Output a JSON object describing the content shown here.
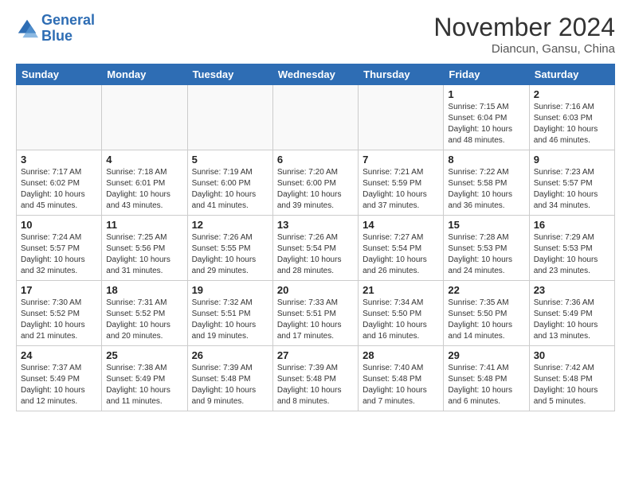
{
  "header": {
    "logo_line1": "General",
    "logo_line2": "Blue",
    "month": "November 2024",
    "location": "Diancun, Gansu, China"
  },
  "days_of_week": [
    "Sunday",
    "Monday",
    "Tuesday",
    "Wednesday",
    "Thursday",
    "Friday",
    "Saturday"
  ],
  "weeks": [
    [
      {
        "day": "",
        "info": ""
      },
      {
        "day": "",
        "info": ""
      },
      {
        "day": "",
        "info": ""
      },
      {
        "day": "",
        "info": ""
      },
      {
        "day": "",
        "info": ""
      },
      {
        "day": "1",
        "info": "Sunrise: 7:15 AM\nSunset: 6:04 PM\nDaylight: 10 hours and 48 minutes."
      },
      {
        "day": "2",
        "info": "Sunrise: 7:16 AM\nSunset: 6:03 PM\nDaylight: 10 hours and 46 minutes."
      }
    ],
    [
      {
        "day": "3",
        "info": "Sunrise: 7:17 AM\nSunset: 6:02 PM\nDaylight: 10 hours and 45 minutes."
      },
      {
        "day": "4",
        "info": "Sunrise: 7:18 AM\nSunset: 6:01 PM\nDaylight: 10 hours and 43 minutes."
      },
      {
        "day": "5",
        "info": "Sunrise: 7:19 AM\nSunset: 6:00 PM\nDaylight: 10 hours and 41 minutes."
      },
      {
        "day": "6",
        "info": "Sunrise: 7:20 AM\nSunset: 6:00 PM\nDaylight: 10 hours and 39 minutes."
      },
      {
        "day": "7",
        "info": "Sunrise: 7:21 AM\nSunset: 5:59 PM\nDaylight: 10 hours and 37 minutes."
      },
      {
        "day": "8",
        "info": "Sunrise: 7:22 AM\nSunset: 5:58 PM\nDaylight: 10 hours and 36 minutes."
      },
      {
        "day": "9",
        "info": "Sunrise: 7:23 AM\nSunset: 5:57 PM\nDaylight: 10 hours and 34 minutes."
      }
    ],
    [
      {
        "day": "10",
        "info": "Sunrise: 7:24 AM\nSunset: 5:57 PM\nDaylight: 10 hours and 32 minutes."
      },
      {
        "day": "11",
        "info": "Sunrise: 7:25 AM\nSunset: 5:56 PM\nDaylight: 10 hours and 31 minutes."
      },
      {
        "day": "12",
        "info": "Sunrise: 7:26 AM\nSunset: 5:55 PM\nDaylight: 10 hours and 29 minutes."
      },
      {
        "day": "13",
        "info": "Sunrise: 7:26 AM\nSunset: 5:54 PM\nDaylight: 10 hours and 28 minutes."
      },
      {
        "day": "14",
        "info": "Sunrise: 7:27 AM\nSunset: 5:54 PM\nDaylight: 10 hours and 26 minutes."
      },
      {
        "day": "15",
        "info": "Sunrise: 7:28 AM\nSunset: 5:53 PM\nDaylight: 10 hours and 24 minutes."
      },
      {
        "day": "16",
        "info": "Sunrise: 7:29 AM\nSunset: 5:53 PM\nDaylight: 10 hours and 23 minutes."
      }
    ],
    [
      {
        "day": "17",
        "info": "Sunrise: 7:30 AM\nSunset: 5:52 PM\nDaylight: 10 hours and 21 minutes."
      },
      {
        "day": "18",
        "info": "Sunrise: 7:31 AM\nSunset: 5:52 PM\nDaylight: 10 hours and 20 minutes."
      },
      {
        "day": "19",
        "info": "Sunrise: 7:32 AM\nSunset: 5:51 PM\nDaylight: 10 hours and 19 minutes."
      },
      {
        "day": "20",
        "info": "Sunrise: 7:33 AM\nSunset: 5:51 PM\nDaylight: 10 hours and 17 minutes."
      },
      {
        "day": "21",
        "info": "Sunrise: 7:34 AM\nSunset: 5:50 PM\nDaylight: 10 hours and 16 minutes."
      },
      {
        "day": "22",
        "info": "Sunrise: 7:35 AM\nSunset: 5:50 PM\nDaylight: 10 hours and 14 minutes."
      },
      {
        "day": "23",
        "info": "Sunrise: 7:36 AM\nSunset: 5:49 PM\nDaylight: 10 hours and 13 minutes."
      }
    ],
    [
      {
        "day": "24",
        "info": "Sunrise: 7:37 AM\nSunset: 5:49 PM\nDaylight: 10 hours and 12 minutes."
      },
      {
        "day": "25",
        "info": "Sunrise: 7:38 AM\nSunset: 5:49 PM\nDaylight: 10 hours and 11 minutes."
      },
      {
        "day": "26",
        "info": "Sunrise: 7:39 AM\nSunset: 5:48 PM\nDaylight: 10 hours and 9 minutes."
      },
      {
        "day": "27",
        "info": "Sunrise: 7:39 AM\nSunset: 5:48 PM\nDaylight: 10 hours and 8 minutes."
      },
      {
        "day": "28",
        "info": "Sunrise: 7:40 AM\nSunset: 5:48 PM\nDaylight: 10 hours and 7 minutes."
      },
      {
        "day": "29",
        "info": "Sunrise: 7:41 AM\nSunset: 5:48 PM\nDaylight: 10 hours and 6 minutes."
      },
      {
        "day": "30",
        "info": "Sunrise: 7:42 AM\nSunset: 5:48 PM\nDaylight: 10 hours and 5 minutes."
      }
    ]
  ]
}
